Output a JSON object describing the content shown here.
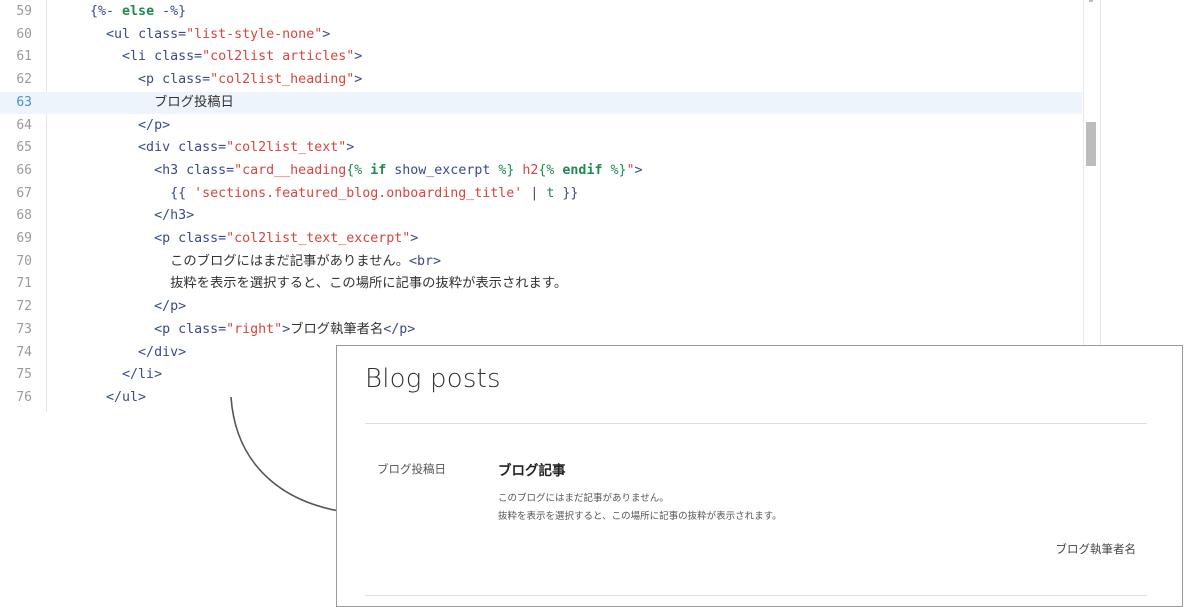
{
  "editor": {
    "highlighted_line": "63",
    "lines": [
      {
        "n": "59",
        "parts": [
          [
            "t",
            "    {%- "
          ],
          [
            "kb",
            "else"
          ],
          [
            "t",
            " -%}"
          ]
        ]
      },
      {
        "n": "60",
        "parts": [
          [
            "t",
            "      <ul "
          ],
          [
            "t",
            "class="
          ],
          [
            "s",
            "\"list-style-none\""
          ],
          [
            "t",
            ">"
          ]
        ]
      },
      {
        "n": "61",
        "parts": [
          [
            "t",
            "        <li "
          ],
          [
            "t",
            "class="
          ],
          [
            "s",
            "\"col2list articles\""
          ],
          [
            "t",
            ">"
          ]
        ]
      },
      {
        "n": "62",
        "parts": [
          [
            "t",
            "          <p "
          ],
          [
            "t",
            "class="
          ],
          [
            "s",
            "\"col2list_heading\""
          ],
          [
            "t",
            ">"
          ]
        ]
      },
      {
        "n": "63",
        "parts": [
          [
            "j",
            "            ブログ投稿日"
          ]
        ]
      },
      {
        "n": "64",
        "parts": [
          [
            "t",
            "          </p>"
          ]
        ]
      },
      {
        "n": "65",
        "parts": [
          [
            "t",
            "          <div "
          ],
          [
            "t",
            "class="
          ],
          [
            "s",
            "\"col2list_text\""
          ],
          [
            "t",
            ">"
          ]
        ]
      },
      {
        "n": "66",
        "parts": [
          [
            "t",
            "            <h3 "
          ],
          [
            "t",
            "class="
          ],
          [
            "s",
            "\"card__heading"
          ],
          [
            "k",
            "{% "
          ],
          [
            "kb",
            "if"
          ],
          [
            "t",
            " show_excerpt "
          ],
          [
            "k",
            "%}"
          ],
          [
            "s",
            " h2"
          ],
          [
            "k",
            "{% "
          ],
          [
            "kb",
            "endif"
          ],
          [
            "k",
            " %}"
          ],
          [
            "s",
            "\""
          ],
          [
            "t",
            ">"
          ]
        ]
      },
      {
        "n": "67",
        "parts": [
          [
            "t",
            "              {{ "
          ],
          [
            "s",
            "'sections.featured_blog.onboarding_title'"
          ],
          [
            "t",
            " | "
          ],
          [
            "k",
            "t"
          ],
          [
            "t",
            " }}"
          ]
        ]
      },
      {
        "n": "68",
        "parts": [
          [
            "t",
            "            </h3>"
          ]
        ]
      },
      {
        "n": "69",
        "parts": [
          [
            "t",
            "            <p "
          ],
          [
            "t",
            "class="
          ],
          [
            "s",
            "\"col2list_text_excerpt\""
          ],
          [
            "t",
            ">"
          ]
        ]
      },
      {
        "n": "70",
        "parts": [
          [
            "j",
            "              このブログにはまだ記事がありません。"
          ],
          [
            "t",
            "<br>"
          ]
        ]
      },
      {
        "n": "71",
        "parts": [
          [
            "j",
            "              抜粋を表示を選択すると、この場所に記事の抜粋が表示されます。"
          ]
        ]
      },
      {
        "n": "72",
        "parts": [
          [
            "t",
            "            </p>"
          ]
        ]
      },
      {
        "n": "73",
        "parts": [
          [
            "t",
            "            <p "
          ],
          [
            "t",
            "class="
          ],
          [
            "s",
            "\"right\""
          ],
          [
            "t",
            ">"
          ],
          [
            "j",
            "ブログ執筆者名"
          ],
          [
            "t",
            "</p>"
          ]
        ]
      },
      {
        "n": "74",
        "parts": [
          [
            "t",
            "          </div>"
          ]
        ]
      },
      {
        "n": "75",
        "parts": [
          [
            "t",
            "        </li>"
          ]
        ]
      },
      {
        "n": "76",
        "parts": [
          [
            "t",
            "      </ul>"
          ]
        ]
      }
    ]
  },
  "preview": {
    "title": "Blog posts",
    "date_label": "ブログ投稿日",
    "heading": "ブログ記事",
    "excerpt_line1": "このブログにはまだ記事がありません。",
    "excerpt_line2": "抜粋を表示を選択すると、この場所に記事の抜粋が表示されます。",
    "author": "ブログ執筆者名"
  },
  "colors": {
    "tag": "#3a4a8c",
    "string": "#d8453d",
    "keyword": "#1f8a52",
    "highlight_row": "#eef4fb"
  }
}
